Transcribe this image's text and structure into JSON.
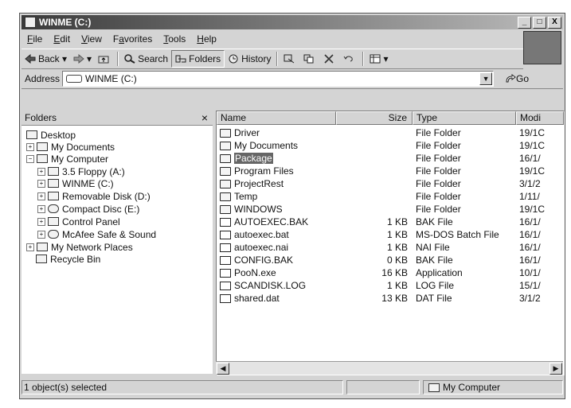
{
  "window": {
    "title": "WINME (C:)",
    "controls": {
      "minimize": "_",
      "maximize": "□",
      "close": "X"
    }
  },
  "menu": [
    {
      "pre": "",
      "u": "F",
      "post": "ile"
    },
    {
      "pre": "",
      "u": "E",
      "post": "dit"
    },
    {
      "pre": "",
      "u": "V",
      "post": "iew"
    },
    {
      "pre": "F",
      "u": "a",
      "post": "vorites"
    },
    {
      "pre": "",
      "u": "T",
      "post": "ools"
    },
    {
      "pre": "",
      "u": "H",
      "post": "elp"
    }
  ],
  "toolbar": {
    "back": "Back",
    "search": "Search",
    "folders": "Folders",
    "history": "History"
  },
  "address": {
    "label": "Address",
    "value": "WINME (C:)",
    "go": "Go"
  },
  "folders_pane": {
    "title": "Folders",
    "close": "×",
    "items": [
      {
        "label": "Desktop",
        "expander": ""
      },
      {
        "label": "My Documents",
        "expander": "+"
      },
      {
        "label": "My Computer",
        "expander": "−"
      },
      {
        "label": "3.5 Floppy (A:)",
        "expander": "+"
      },
      {
        "label": "WINME (C:)",
        "expander": "+"
      },
      {
        "label": "Removable Disk (D:)",
        "expander": "+"
      },
      {
        "label": "Compact Disc (E:)",
        "expander": "+"
      },
      {
        "label": "Control Panel",
        "expander": "+"
      },
      {
        "label": "McAfee Safe & Sound",
        "expander": "+"
      },
      {
        "label": "My Network Places",
        "expander": "+"
      },
      {
        "label": "Recycle Bin",
        "expander": ""
      }
    ]
  },
  "file_list": {
    "columns": {
      "name": "Name",
      "size": "Size",
      "type": "Type",
      "modified": "Modi"
    },
    "rows": [
      {
        "name": "Driver",
        "size": "",
        "type": "File Folder",
        "modified": "19/1C"
      },
      {
        "name": "My Documents",
        "size": "",
        "type": "File Folder",
        "modified": "19/1C"
      },
      {
        "name": "Package",
        "size": "",
        "type": "File Folder",
        "modified": "16/1/"
      },
      {
        "name": "Program Files",
        "size": "",
        "type": "File Folder",
        "modified": "19/1C"
      },
      {
        "name": "ProjectRest",
        "size": "",
        "type": "File Folder",
        "modified": "3/1/2"
      },
      {
        "name": "Temp",
        "size": "",
        "type": "File Folder",
        "modified": "1/11/"
      },
      {
        "name": "WINDOWS",
        "size": "",
        "type": "File Folder",
        "modified": "19/1C"
      },
      {
        "name": "AUTOEXEC.BAK",
        "size": "1 KB",
        "type": "BAK File",
        "modified": "16/1/"
      },
      {
        "name": "autoexec.bat",
        "size": "1 KB",
        "type": "MS-DOS Batch File",
        "modified": "16/1/"
      },
      {
        "name": "autoexec.nai",
        "size": "1 KB",
        "type": "NAI File",
        "modified": "16/1/"
      },
      {
        "name": "CONFIG.BAK",
        "size": "0 KB",
        "type": "BAK File",
        "modified": "16/1/"
      },
      {
        "name": "PooN.exe",
        "size": "16 KB",
        "type": "Application",
        "modified": "10/1/"
      },
      {
        "name": "SCANDISK.LOG",
        "size": "1 KB",
        "type": "LOG File",
        "modified": "15/1/"
      },
      {
        "name": "shared.dat",
        "size": "13 KB",
        "type": "DAT File",
        "modified": "3/1/2"
      }
    ],
    "selected_index": 2
  },
  "status": {
    "selection": "1 object(s) selected",
    "location": "My Computer"
  }
}
